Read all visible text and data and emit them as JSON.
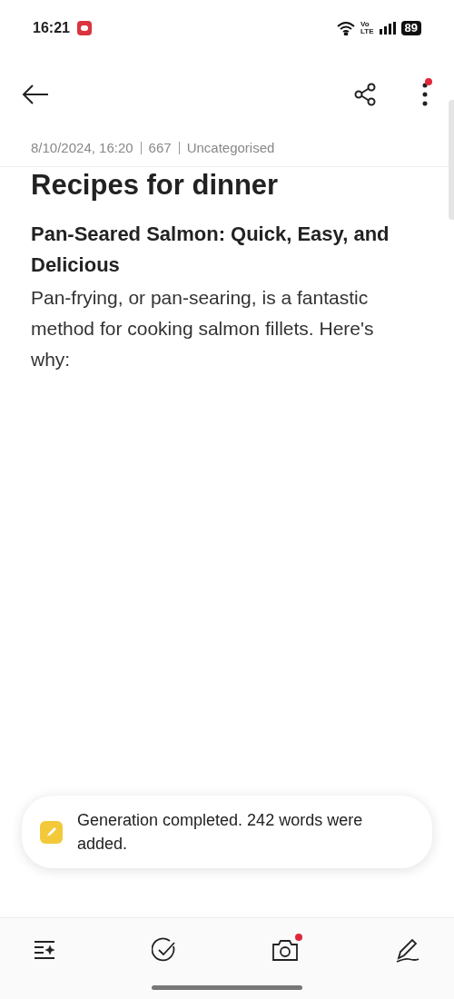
{
  "status_bar": {
    "time": "16:21",
    "network": [
      "Vo",
      "LTE"
    ],
    "battery": "89"
  },
  "toolbar": {
    "actions": [
      {
        "kind": "share",
        "notification_dot": false
      },
      {
        "kind": "more",
        "notification_dot": true
      }
    ]
  },
  "note": {
    "meta": [
      "8/10/2024, 16:20",
      "667",
      "Uncategorised"
    ],
    "title": "Recipes for dinner",
    "heading": "Pan-Seared Salmon: Quick, Easy, and Delicious",
    "body": "Pan-frying, or pan-searing, is a fantastic method for cooking salmon fillets. Here's why:"
  },
  "toast": {
    "message": "Generation completed. 242 words were added."
  },
  "bottom_bar": [
    {
      "kind": "ai-format",
      "notification_dot": false
    },
    {
      "kind": "checklist",
      "notification_dot": false
    },
    {
      "kind": "camera",
      "notification_dot": true
    },
    {
      "kind": "draw",
      "notification_dot": false
    }
  ]
}
